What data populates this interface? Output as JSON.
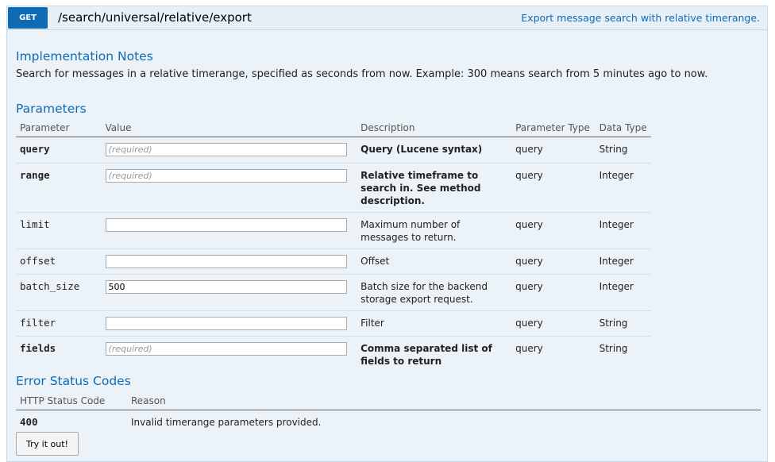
{
  "operation": {
    "method": "GET",
    "path": "/search/universal/relative/export",
    "summary": "Export message search with relative timerange."
  },
  "implementation_notes": {
    "title": "Implementation Notes",
    "text": "Search for messages in a relative timerange, specified as seconds from now. Example: 300 means search from 5 minutes ago to now."
  },
  "parameters": {
    "title": "Parameters",
    "columns": [
      "Parameter",
      "Value",
      "Description",
      "Parameter Type",
      "Data Type"
    ],
    "rows": [
      {
        "name": "query",
        "value": "",
        "placeholder": "(required)",
        "description": "Query (Lucene syntax)",
        "param_type": "query",
        "data_type": "String",
        "required": true
      },
      {
        "name": "range",
        "value": "",
        "placeholder": "(required)",
        "description": "Relative timeframe to search in. See method description.",
        "param_type": "query",
        "data_type": "Integer",
        "required": true
      },
      {
        "name": "limit",
        "value": "",
        "placeholder": "",
        "description": "Maximum number of messages to return.",
        "param_type": "query",
        "data_type": "Integer",
        "required": false
      },
      {
        "name": "offset",
        "value": "",
        "placeholder": "",
        "description": "Offset",
        "param_type": "query",
        "data_type": "Integer",
        "required": false
      },
      {
        "name": "batch_size",
        "value": "500",
        "placeholder": "",
        "description": "Batch size for the backend storage export request.",
        "param_type": "query",
        "data_type": "Integer",
        "required": false
      },
      {
        "name": "filter",
        "value": "",
        "placeholder": "",
        "description": "Filter",
        "param_type": "query",
        "data_type": "String",
        "required": false
      },
      {
        "name": "fields",
        "value": "",
        "placeholder": "(required)",
        "description": "Comma separated list of fields to return",
        "param_type": "query",
        "data_type": "String",
        "required": true
      }
    ]
  },
  "error_codes": {
    "title": "Error Status Codes",
    "columns": [
      "HTTP Status Code",
      "Reason"
    ],
    "rows": [
      {
        "code": "400",
        "reason": "Invalid timerange parameters provided."
      }
    ]
  },
  "try_button": "Try it out!",
  "colors": {
    "accent": "#0f6ab4",
    "panel_bg": "#ebf3f9",
    "panel_border": "#c5d9e8"
  }
}
